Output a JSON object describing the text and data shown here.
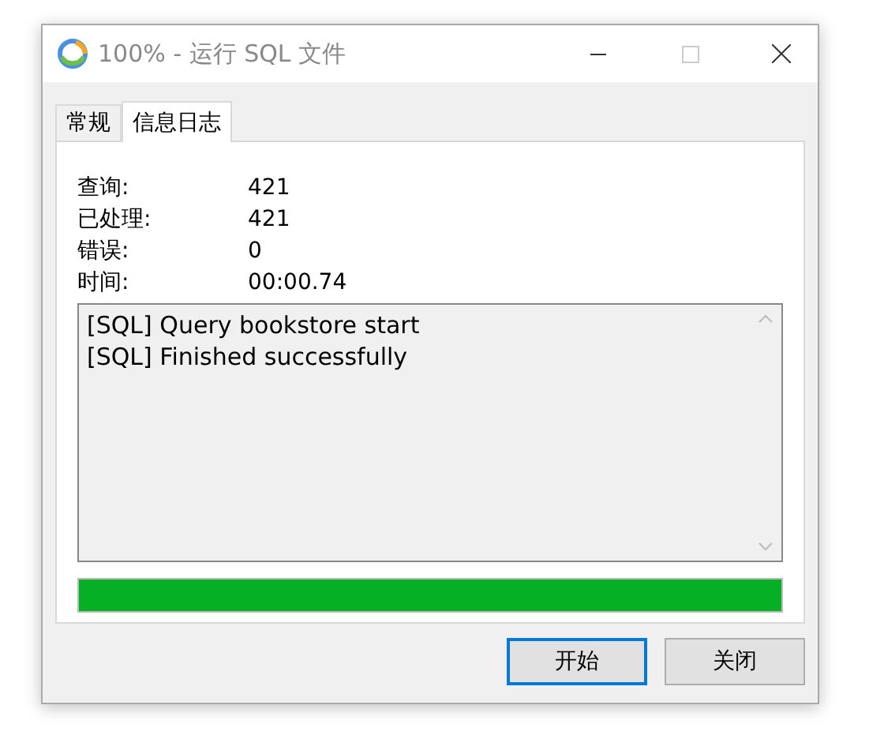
{
  "window": {
    "title": "100% - 运行 SQL 文件"
  },
  "tabs": [
    {
      "label": "常规",
      "selected": false
    },
    {
      "label": "信息日志",
      "selected": true
    }
  ],
  "stats": [
    {
      "label": "查询:",
      "value": "421"
    },
    {
      "label": "已处理:",
      "value": "421"
    },
    {
      "label": "错误:",
      "value": "0"
    },
    {
      "label": "时间:",
      "value": "00:00.74"
    }
  ],
  "log": [
    "[SQL] Query bookstore start",
    "[SQL] Finished successfully"
  ],
  "progress": {
    "level": 1
  },
  "buttons": [
    {
      "label": "开始",
      "focused": true
    },
    {
      "label": "关闭",
      "focused": false
    }
  ]
}
